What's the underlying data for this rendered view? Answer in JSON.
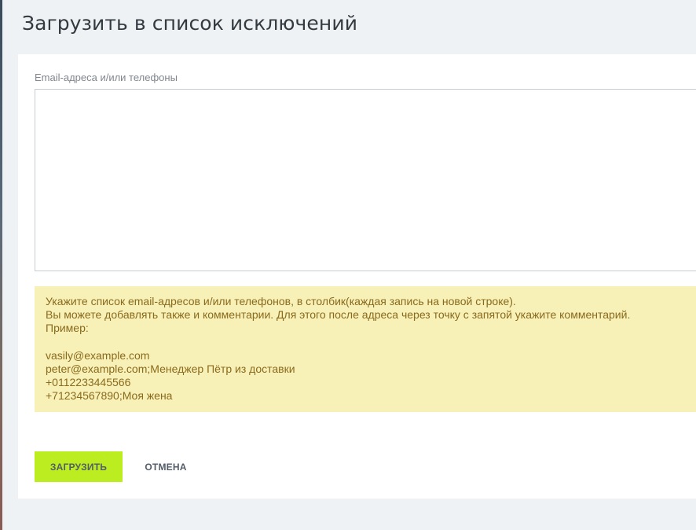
{
  "page": {
    "title": "Загрузить в список исключений"
  },
  "form": {
    "field_label": "Email-адреса и/или телефоны",
    "textarea_value": "",
    "hint_lines": [
      "Укажите список email-адресов и/или телефонов, в столбик(каждая запись на новой строке).",
      "Вы можете добавлять также и комментарии. Для этого после адреса через точку с запятой укажите комментарий.",
      "Пример:",
      "",
      "vasily@example.com",
      "peter@example.com;Менеджер Пётр из доставки",
      "+0112233445566",
      "+71234567890;Моя жена"
    ]
  },
  "buttons": {
    "upload_label": "ЗАГРУЗИТЬ",
    "cancel_label": "ОТМЕНА"
  },
  "colors": {
    "upload_button_bg": "#bbed21",
    "hint_bg": "#f7f1b8",
    "hint_text": "#8a6a1c",
    "page_bg": "#eef2f4"
  }
}
